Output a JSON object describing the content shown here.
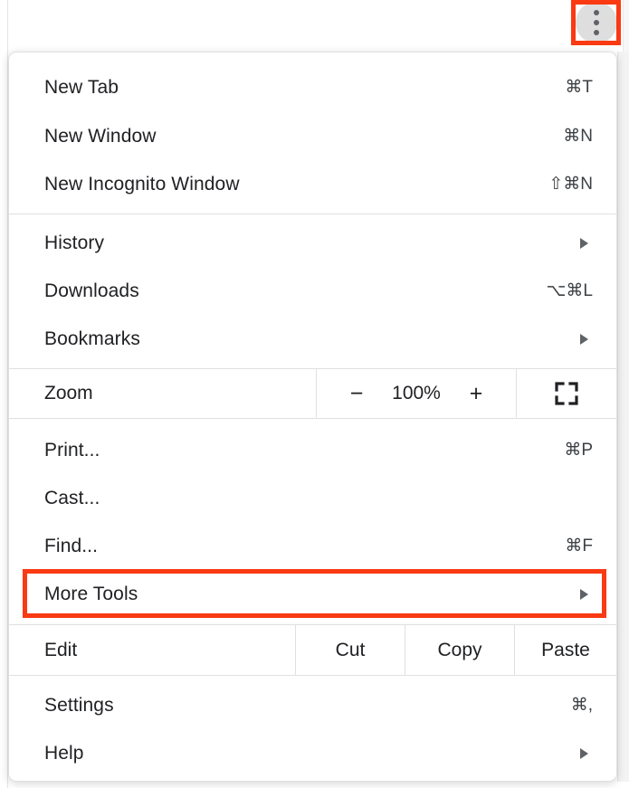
{
  "menu_button": {
    "name": "Chrome three-dot menu",
    "icon": "three-dots-vertical-icon",
    "highlighted": true,
    "highlight_color": "#f93a13"
  },
  "menu": {
    "sections": [
      {
        "id": "new",
        "items": [
          {
            "label": "New Tab",
            "accel": "⌘T",
            "submenu": false
          },
          {
            "label": "New Window",
            "accel": "⌘N",
            "submenu": false
          },
          {
            "label": "New Incognito Window",
            "accel": "⇧⌘N",
            "submenu": false
          }
        ]
      },
      {
        "id": "history",
        "items": [
          {
            "label": "History",
            "accel": "",
            "submenu": true
          },
          {
            "label": "Downloads",
            "accel": "⌥⌘L",
            "submenu": false
          },
          {
            "label": "Bookmarks",
            "accel": "",
            "submenu": true
          }
        ]
      }
    ],
    "zoom_row": {
      "label": "Zoom",
      "decrease_label": "−",
      "value": "100%",
      "increase_label": "+",
      "fullscreen_icon": "fullscreen-icon"
    },
    "tools_section": {
      "items": [
        {
          "label": "Print...",
          "accel": "⌘P",
          "submenu": false
        },
        {
          "label": "Cast...",
          "accel": "",
          "submenu": false
        },
        {
          "label": "Find...",
          "accel": "⌘F",
          "submenu": false
        },
        {
          "label": "More Tools",
          "accel": "",
          "submenu": true,
          "highlighted": true
        }
      ]
    },
    "edit_row": {
      "label": "Edit",
      "actions": [
        "Cut",
        "Copy",
        "Paste"
      ]
    },
    "settings_section": {
      "items": [
        {
          "label": "Settings",
          "accel": "⌘,",
          "submenu": false
        },
        {
          "label": "Help",
          "accel": "",
          "submenu": true
        }
      ]
    }
  },
  "annotations": {
    "highlight_color": "#f93a13",
    "targets": [
      "three-dot-menu-button",
      "More Tools"
    ]
  }
}
